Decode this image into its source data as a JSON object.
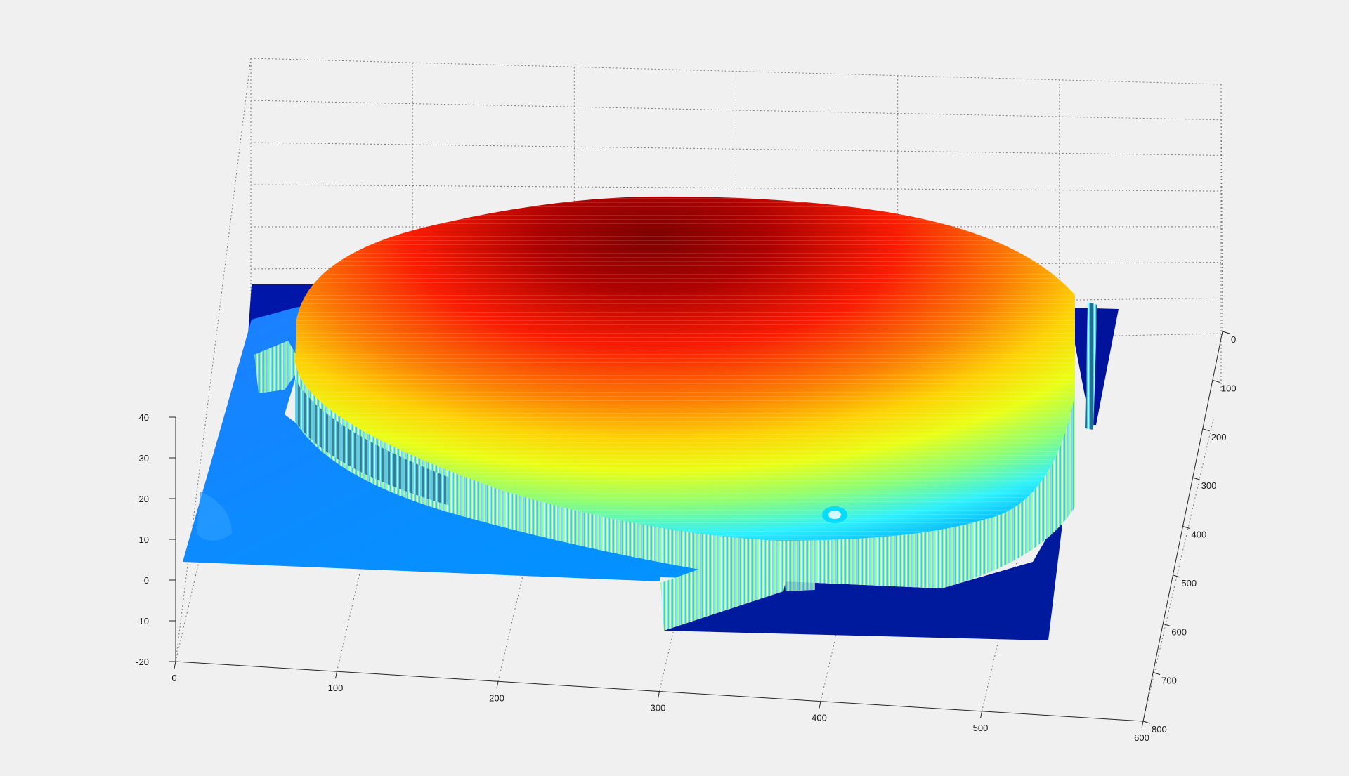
{
  "chart_data": {
    "type": "surface",
    "title": "",
    "xlabel": "",
    "ylabel": "",
    "zlabel": "",
    "colormap": "jet",
    "background": "#f0f0f0",
    "grid": true,
    "xlim": [
      0,
      600
    ],
    "ylim": [
      0,
      800
    ],
    "zlim": [
      -20,
      40
    ],
    "x_ticks": [
      "0",
      "100",
      "200",
      "300",
      "400",
      "500",
      "600"
    ],
    "y_ticks": [
      "0",
      "100",
      "200",
      "300",
      "400",
      "500",
      "600",
      "700",
      "800"
    ],
    "z_ticks": [
      "-20",
      "-10",
      "0",
      "10",
      "20",
      "30",
      "40"
    ],
    "surface": {
      "dome_center": [
        300,
        370
      ],
      "dome_radius": [
        290,
        330
      ],
      "dome_peak_z": 45,
      "dome_rim_z": 15,
      "plateau_z": 5,
      "floor_z": -20
    }
  }
}
